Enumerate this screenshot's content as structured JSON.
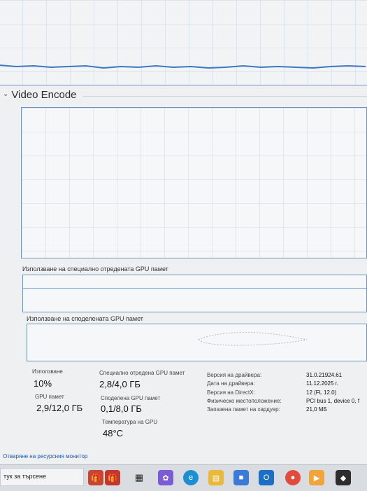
{
  "video_encode": {
    "title": "Video Encode"
  },
  "dedicated_memory_label": "Използване на специално отредената GPU памет",
  "shared_memory_label": "Използване на споделената GPU памет",
  "stats": {
    "utilization_label": "Използване",
    "utilization_value": "10%",
    "dedicated_label": "Специално отредена GPU памет",
    "dedicated_value": "2,8/4,0 ГБ",
    "gpu_memory_label": "GPU памет",
    "gpu_memory_value": "2,9/12,0 ГБ",
    "shared_label": "Споделена GPU памет",
    "shared_value": "0,1/8,0 ГБ",
    "temperature_label": "Температура на GPU",
    "temperature_value": "48°C"
  },
  "info": [
    {
      "label": "Версия на драйвера:",
      "value": "31.0.21924.61"
    },
    {
      "label": "Дата на драйвера:",
      "value": "11.12.2025 г."
    },
    {
      "label": "Версия на DirectX:",
      "value": "12 (FL 12.0)"
    },
    {
      "label": "Физическо местоположение:",
      "value": "PCI bus 1, device 0, f"
    },
    {
      "label": "Запазена памет на хардуер:",
      "value": "21,0 МБ"
    }
  ],
  "footer_link": "Отваряне на ресурсния монитор",
  "taskbar": {
    "search_text": "тук за търсене",
    "icons": [
      "gift-icon",
      "task-view-icon",
      "copilot-icon",
      "edge-icon",
      "file-explorer-icon",
      "store-icon",
      "outlook-icon",
      "chrome-icon",
      "media-icon",
      "app-icon"
    ]
  },
  "colors": {
    "graph_border": "#6f93bf",
    "graph_line": "#3b78c2",
    "link": "#1a55b5"
  }
}
